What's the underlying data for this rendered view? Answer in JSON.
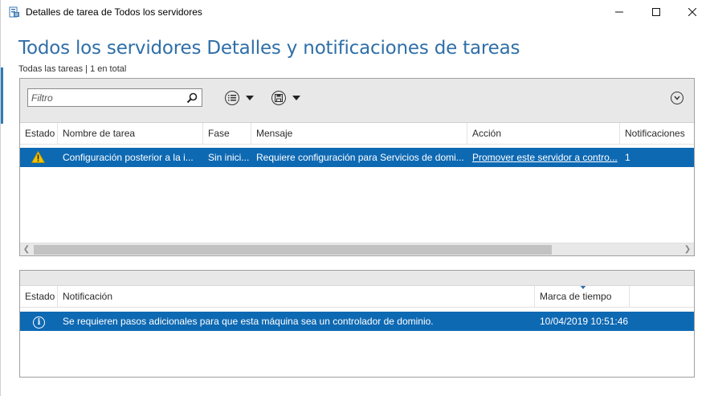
{
  "window": {
    "title": "Detalles de tarea de Todos los servidores",
    "icon": "server-manager-icon",
    "controls": {
      "minimize": "—",
      "maximize": "☐",
      "close": "✕"
    }
  },
  "heading": "Todos los servidores Detalles y notificaciones de tareas",
  "subheading": "Todas las tareas | 1 en total",
  "toolbar": {
    "filter_placeholder": "Filtro",
    "icons": [
      "search-icon",
      "list-options-icon",
      "save-icon",
      "expand-icon"
    ]
  },
  "tasks": {
    "columns": [
      "Estado",
      "Nombre de tarea",
      "Fase",
      "Mensaje",
      "Acción",
      "Notificaciones"
    ],
    "rows": [
      {
        "status_icon": "warning-icon",
        "name": "Configuración posterior a la i...",
        "phase": "Sin inici...",
        "message": "Requiere configuración para Servicios de domi...",
        "action": "Promover este servidor a contro...",
        "notifications": "1"
      }
    ]
  },
  "notifications": {
    "columns": [
      "Estado",
      "Notificación",
      "Marca de tiempo"
    ],
    "rows": [
      {
        "status_icon": "info-icon",
        "text": "Se requieren pasos adicionales para que esta máquina sea un controlador de dominio.",
        "timestamp": "10/04/2019 10:51:46"
      }
    ]
  },
  "colors": {
    "accent": "#2f6fa8",
    "selection": "#0e69b3",
    "toolbar_bg": "#e8e8e8",
    "warning": "#f2c500"
  }
}
